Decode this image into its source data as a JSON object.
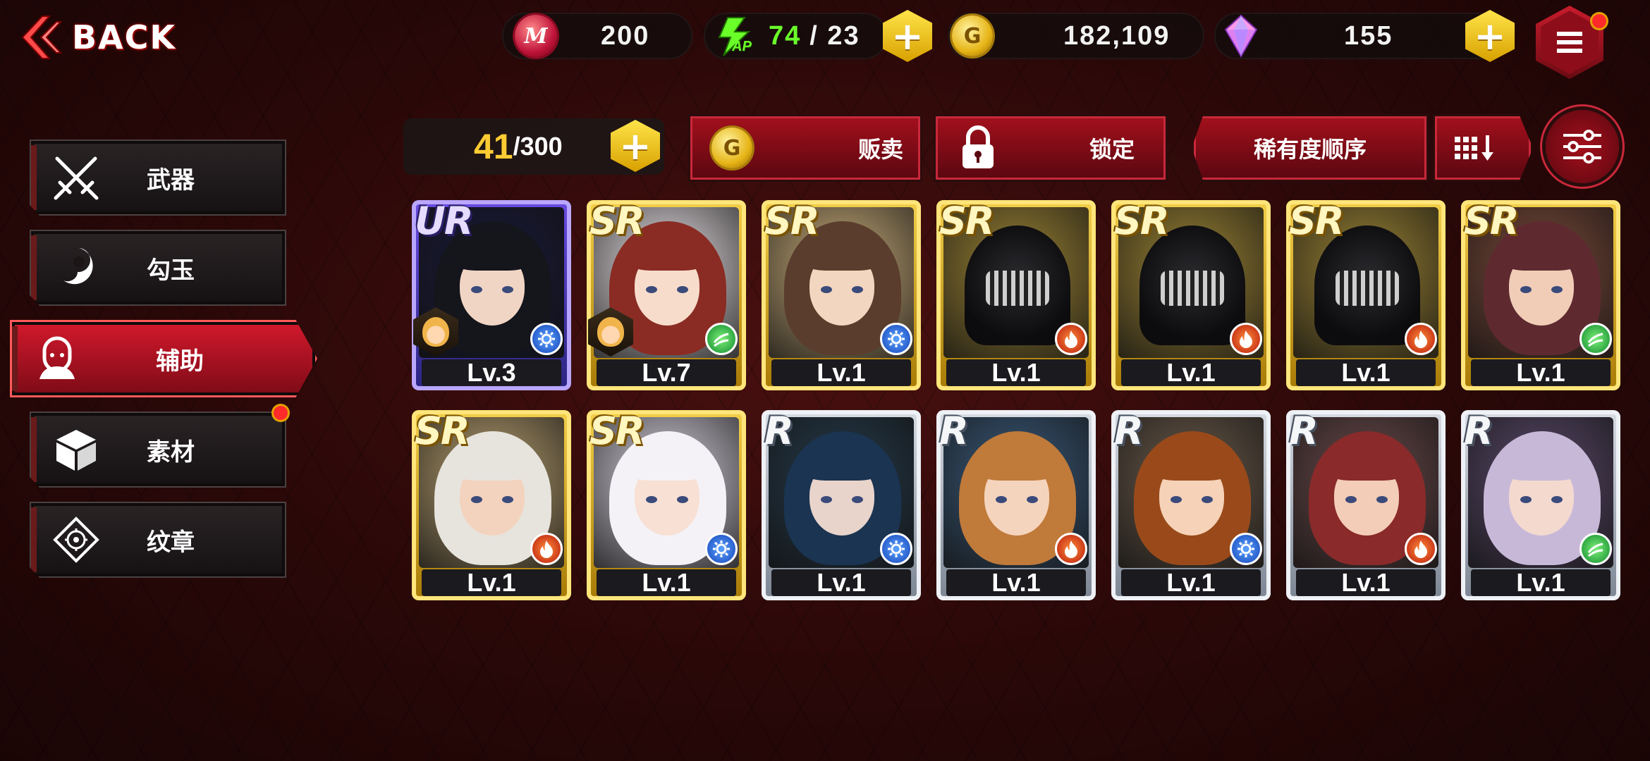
{
  "header": {
    "back_label": "BACK",
    "medals": "200",
    "ap_current": "74",
    "ap_separator": "/ 23",
    "ap_icon_text": "AP",
    "gold": "182,109",
    "gems": "155",
    "coin_m_glyph": "M",
    "coin_g_glyph": "G",
    "plus_glyph": "+"
  },
  "sidebar": {
    "items": [
      {
        "label": "武器",
        "icon": "crossed-swords-icon",
        "active": false,
        "badge": false
      },
      {
        "label": "勾玉",
        "icon": "magatama-icon",
        "active": false,
        "badge": false
      },
      {
        "label": "辅助",
        "icon": "support-character-icon",
        "active": true,
        "badge": false
      },
      {
        "label": "素材",
        "icon": "material-cube-icon",
        "active": false,
        "badge": true
      },
      {
        "label": "纹章",
        "icon": "crest-icon",
        "active": false,
        "badge": false
      }
    ]
  },
  "controls": {
    "capacity_current": "41",
    "capacity_max": "/300",
    "sell_label": "贩卖",
    "lock_label": "锁定",
    "sort_label": "稀有度顺序",
    "order_icon": "grid-sort-desc-icon",
    "filter_icon": "filter-sliders-icon"
  },
  "cards": [
    {
      "rarity": "UR",
      "level": "Lv.3",
      "element": "water",
      "buddy": true
    },
    {
      "rarity": "SR",
      "level": "Lv.7",
      "element": "wind",
      "buddy": true
    },
    {
      "rarity": "SR",
      "level": "Lv.1",
      "element": "water",
      "buddy": false
    },
    {
      "rarity": "SR",
      "level": "Lv.1",
      "element": "fire",
      "buddy": false
    },
    {
      "rarity": "SR",
      "level": "Lv.1",
      "element": "fire",
      "buddy": false
    },
    {
      "rarity": "SR",
      "level": "Lv.1",
      "element": "fire",
      "buddy": false
    },
    {
      "rarity": "SR",
      "level": "Lv.1",
      "element": "wind",
      "buddy": false
    },
    {
      "rarity": "SR",
      "level": "Lv.1",
      "element": "fire",
      "buddy": false
    },
    {
      "rarity": "SR",
      "level": "Lv.1",
      "element": "water",
      "buddy": false
    },
    {
      "rarity": "R",
      "level": "Lv.1",
      "element": "water",
      "buddy": false
    },
    {
      "rarity": "R",
      "level": "Lv.1",
      "element": "fire",
      "buddy": false
    },
    {
      "rarity": "R",
      "level": "Lv.1",
      "element": "water",
      "buddy": false
    },
    {
      "rarity": "R",
      "level": "Lv.1",
      "element": "fire",
      "buddy": false
    },
    {
      "rarity": "R",
      "level": "Lv.1",
      "element": "wind",
      "buddy": false
    }
  ],
  "colors": {
    "accent_red": "#c8283a",
    "gold": "#ffcc33",
    "ap_green": "#6bff2a"
  }
}
